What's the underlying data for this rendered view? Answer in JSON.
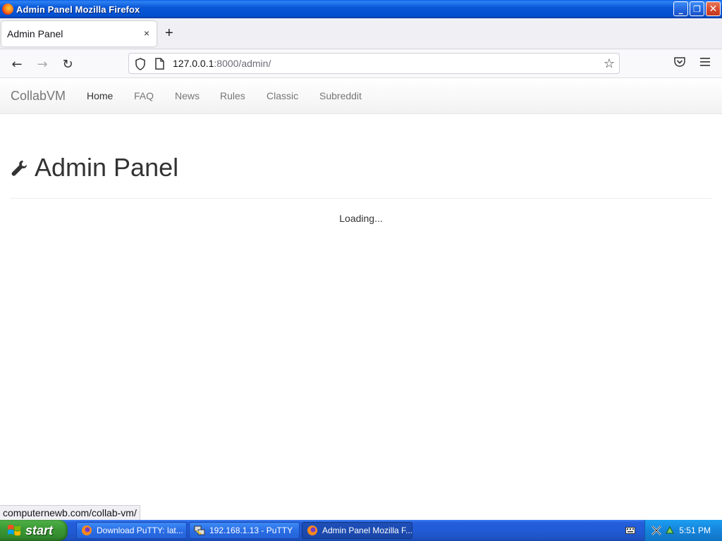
{
  "window": {
    "title": "Admin Panel  Mozilla Firefox",
    "buttons": {
      "minimize": "_",
      "maximize": "❐",
      "close": "✕"
    }
  },
  "tabs": [
    {
      "label": "Admin Panel",
      "close": "×"
    }
  ],
  "newtab_label": "+",
  "navbar": {
    "back": "←",
    "forward": "→",
    "reload": "↻",
    "url_host": "127.0.0.1",
    "url_rest": ":8000/admin/",
    "bookmark": "☆"
  },
  "site": {
    "brand": "CollabVM",
    "links": [
      "Home",
      "FAQ",
      "News",
      "Rules",
      "Classic",
      "Subreddit"
    ],
    "active_link": "Home"
  },
  "content": {
    "heading": "Admin Panel",
    "heading_icon": "wrench-icon",
    "status": "Loading..."
  },
  "status_link": "computernewb.com/collab-vm/",
  "taskbar": {
    "start_label": "start",
    "items": [
      {
        "label": "Download PuTTY: lat...",
        "icon": "firefox-icon"
      },
      {
        "label": "192.168.1.13 - PuTTY",
        "icon": "putty-icon"
      },
      {
        "label": "Admin Panel  Mozilla F...",
        "icon": "firefox-icon",
        "active": true
      }
    ],
    "clock": "5:51 PM"
  },
  "colors": {
    "titlebar": "#0a58d8",
    "taskbar": "#245edc",
    "start": "#3c9a36",
    "tray": "#1584db"
  }
}
